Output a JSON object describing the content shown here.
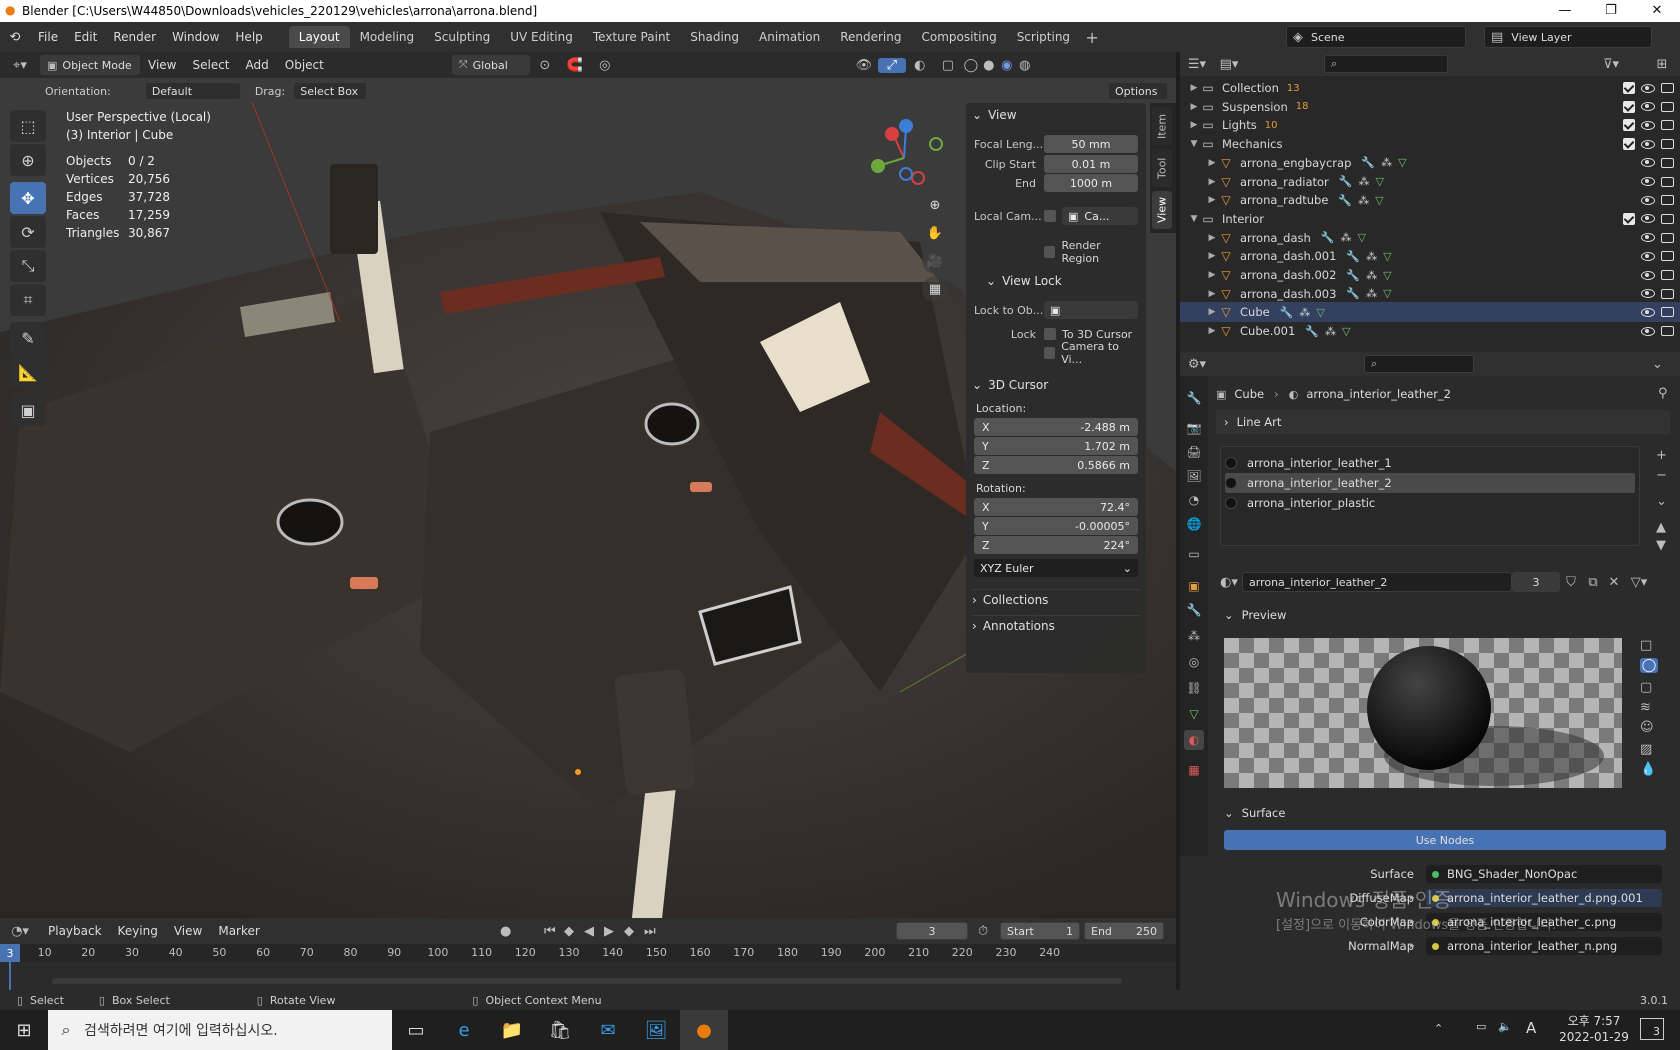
{
  "window": {
    "title": "Blender [C:\\Users\\W44850\\Downloads\\vehicles_220129\\vehicles\\arrona\\arrona.blend]"
  },
  "menu": [
    "File",
    "Edit",
    "Render",
    "Window",
    "Help"
  ],
  "workspaces": [
    "Layout",
    "Modeling",
    "Sculpting",
    "UV Editing",
    "Texture Paint",
    "Shading",
    "Animation",
    "Rendering",
    "Compositing",
    "Scripting"
  ],
  "scene": {
    "name": "Scene",
    "view_layer": "View Layer"
  },
  "viewport_header": {
    "mode": "Object Mode",
    "menus": [
      "View",
      "Select",
      "Add",
      "Object"
    ],
    "transform": "Global"
  },
  "tool_settings": {
    "orientation_label": "Orientation:",
    "orientation": "Default",
    "drag_label": "Drag:",
    "drag": "Select Box",
    "options": "Options"
  },
  "overlay_text": {
    "perspective": "User Perspective (Local)",
    "context": "(3) Interior | Cube"
  },
  "stats": [
    {
      "label": "Objects",
      "value": "0 / 2"
    },
    {
      "label": "Vertices",
      "value": "20,756"
    },
    {
      "label": "Edges",
      "value": "37,728"
    },
    {
      "label": "Faces",
      "value": "17,259"
    },
    {
      "label": "Triangles",
      "value": "30,867"
    }
  ],
  "npanel": {
    "view_header": "View",
    "focal_label": "Focal Leng...",
    "focal": "50 mm",
    "clip_start_label": "Clip Start",
    "clip_start": "0.01 m",
    "clip_end_label": "End",
    "clip_end": "1000 m",
    "local_cam_label": "Local Cam...",
    "local_cam": "Ca...",
    "render_region": "Render Region",
    "view_lock_header": "View Lock",
    "lock_obj_label": "Lock to Ob...",
    "lock_label": "Lock",
    "to_cursor": "To 3D Cursor",
    "cam_to_view": "Camera to Vi...",
    "cursor_header": "3D Cursor",
    "location_label": "Location:",
    "loc": [
      {
        "axis": "X",
        "value": "-2.488 m"
      },
      {
        "axis": "Y",
        "value": "1.702 m"
      },
      {
        "axis": "Z",
        "value": "0.5866 m"
      }
    ],
    "rotation_label": "Rotation:",
    "rot": [
      {
        "axis": "X",
        "value": "72.4°"
      },
      {
        "axis": "Y",
        "value": "-0.00005°"
      },
      {
        "axis": "Z",
        "value": "224°"
      }
    ],
    "rot_mode": "XYZ Euler",
    "collections": "Collections",
    "annotations": "Annotations",
    "tabs": [
      "Item",
      "Tool",
      "View"
    ]
  },
  "outliner": {
    "rows": [
      {
        "name": "Collection",
        "kind": "collection",
        "indent": 0,
        "badge": "13",
        "check": true
      },
      {
        "name": "Suspension",
        "kind": "collection",
        "indent": 0,
        "badge": "18",
        "check": true
      },
      {
        "name": "Lights",
        "kind": "collection",
        "indent": 0,
        "badge": "10",
        "check": true
      },
      {
        "name": "Mechanics",
        "kind": "collection",
        "indent": 0,
        "badge": "",
        "check": true
      },
      {
        "name": "arrona_engbaycrap",
        "kind": "object",
        "indent": 1,
        "badge": "",
        "check": false
      },
      {
        "name": "arrona_radiator",
        "kind": "object",
        "indent": 1,
        "badge": "",
        "check": false
      },
      {
        "name": "arrona_radtube",
        "kind": "object",
        "indent": 1,
        "badge": "",
        "check": false
      },
      {
        "name": "Interior",
        "kind": "collection",
        "indent": 0,
        "badge": "",
        "check": true
      },
      {
        "name": "arrona_dash",
        "kind": "object",
        "indent": 1,
        "badge": "",
        "check": false
      },
      {
        "name": "arrona_dash.001",
        "kind": "object",
        "indent": 1,
        "badge": "",
        "check": false
      },
      {
        "name": "arrona_dash.002",
        "kind": "object",
        "indent": 1,
        "badge": "",
        "check": false
      },
      {
        "name": "arrona_dash.003",
        "kind": "object",
        "indent": 1,
        "badge": "",
        "check": false
      },
      {
        "name": "Cube",
        "kind": "object",
        "indent": 1,
        "badge": "",
        "check": false
      },
      {
        "name": "Cube.001",
        "kind": "object",
        "indent": 1,
        "badge": "",
        "check": false
      }
    ]
  },
  "properties": {
    "breadcrumb_obj": "Cube",
    "breadcrumb_mat": "arrona_interior_leather_2",
    "line_art": "Line Art",
    "materials": [
      "arrona_interior_leather_1",
      "arrona_interior_leather_2",
      "arrona_interior_plastic"
    ],
    "selected_index": 1,
    "material_name": "arrona_interior_leather_2",
    "users": "3",
    "preview": "Preview",
    "surface_header": "Surface",
    "use_nodes": "Use Nodes",
    "sockets": [
      {
        "label": "Surface",
        "value": "BNG_Shader_NonOpac",
        "color": "green"
      },
      {
        "label": "DiffuseMap",
        "value": "arrona_interior_leather_d.png.001",
        "color": "yellow"
      },
      {
        "label": "ColorMap",
        "value": "arrona_interior_leather_c.png",
        "color": "yellow"
      },
      {
        "label": "NormalMap",
        "value": "arrona_interior_leather_n.png",
        "color": "yellow"
      }
    ]
  },
  "watermark": {
    "line1": "Windows 정품 인증",
    "line2": "[설정]으로 이동하여 Windows를 정품 인증합니다."
  },
  "timeline": {
    "menus": [
      "Playback",
      "Keying",
      "View",
      "Marker"
    ],
    "current": "3",
    "start_label": "Start",
    "start": "1",
    "end_label": "End",
    "end": "250",
    "ticks": [
      "3",
      "10",
      "20",
      "30",
      "40",
      "50",
      "60",
      "70",
      "80",
      "90",
      "100",
      "110",
      "120",
      "130",
      "140",
      "150",
      "160",
      "170",
      "180",
      "190",
      "200",
      "210",
      "220",
      "230",
      "240"
    ]
  },
  "statusbar": {
    "select": "Select",
    "box": "Box Select",
    "rotate": "Rotate View",
    "ctx": "Object Context Menu",
    "version": "3.0.1"
  },
  "taskbar": {
    "search": "검색하려면 여기에 입력하십시오.",
    "time": "오후 7:57",
    "date": "2022-01-29",
    "ime": "A",
    "notif": "3"
  },
  "colors": {
    "accent": "#4772b3",
    "object_icon": "#e89a3c",
    "bg_dark": "#1d1d1d"
  }
}
